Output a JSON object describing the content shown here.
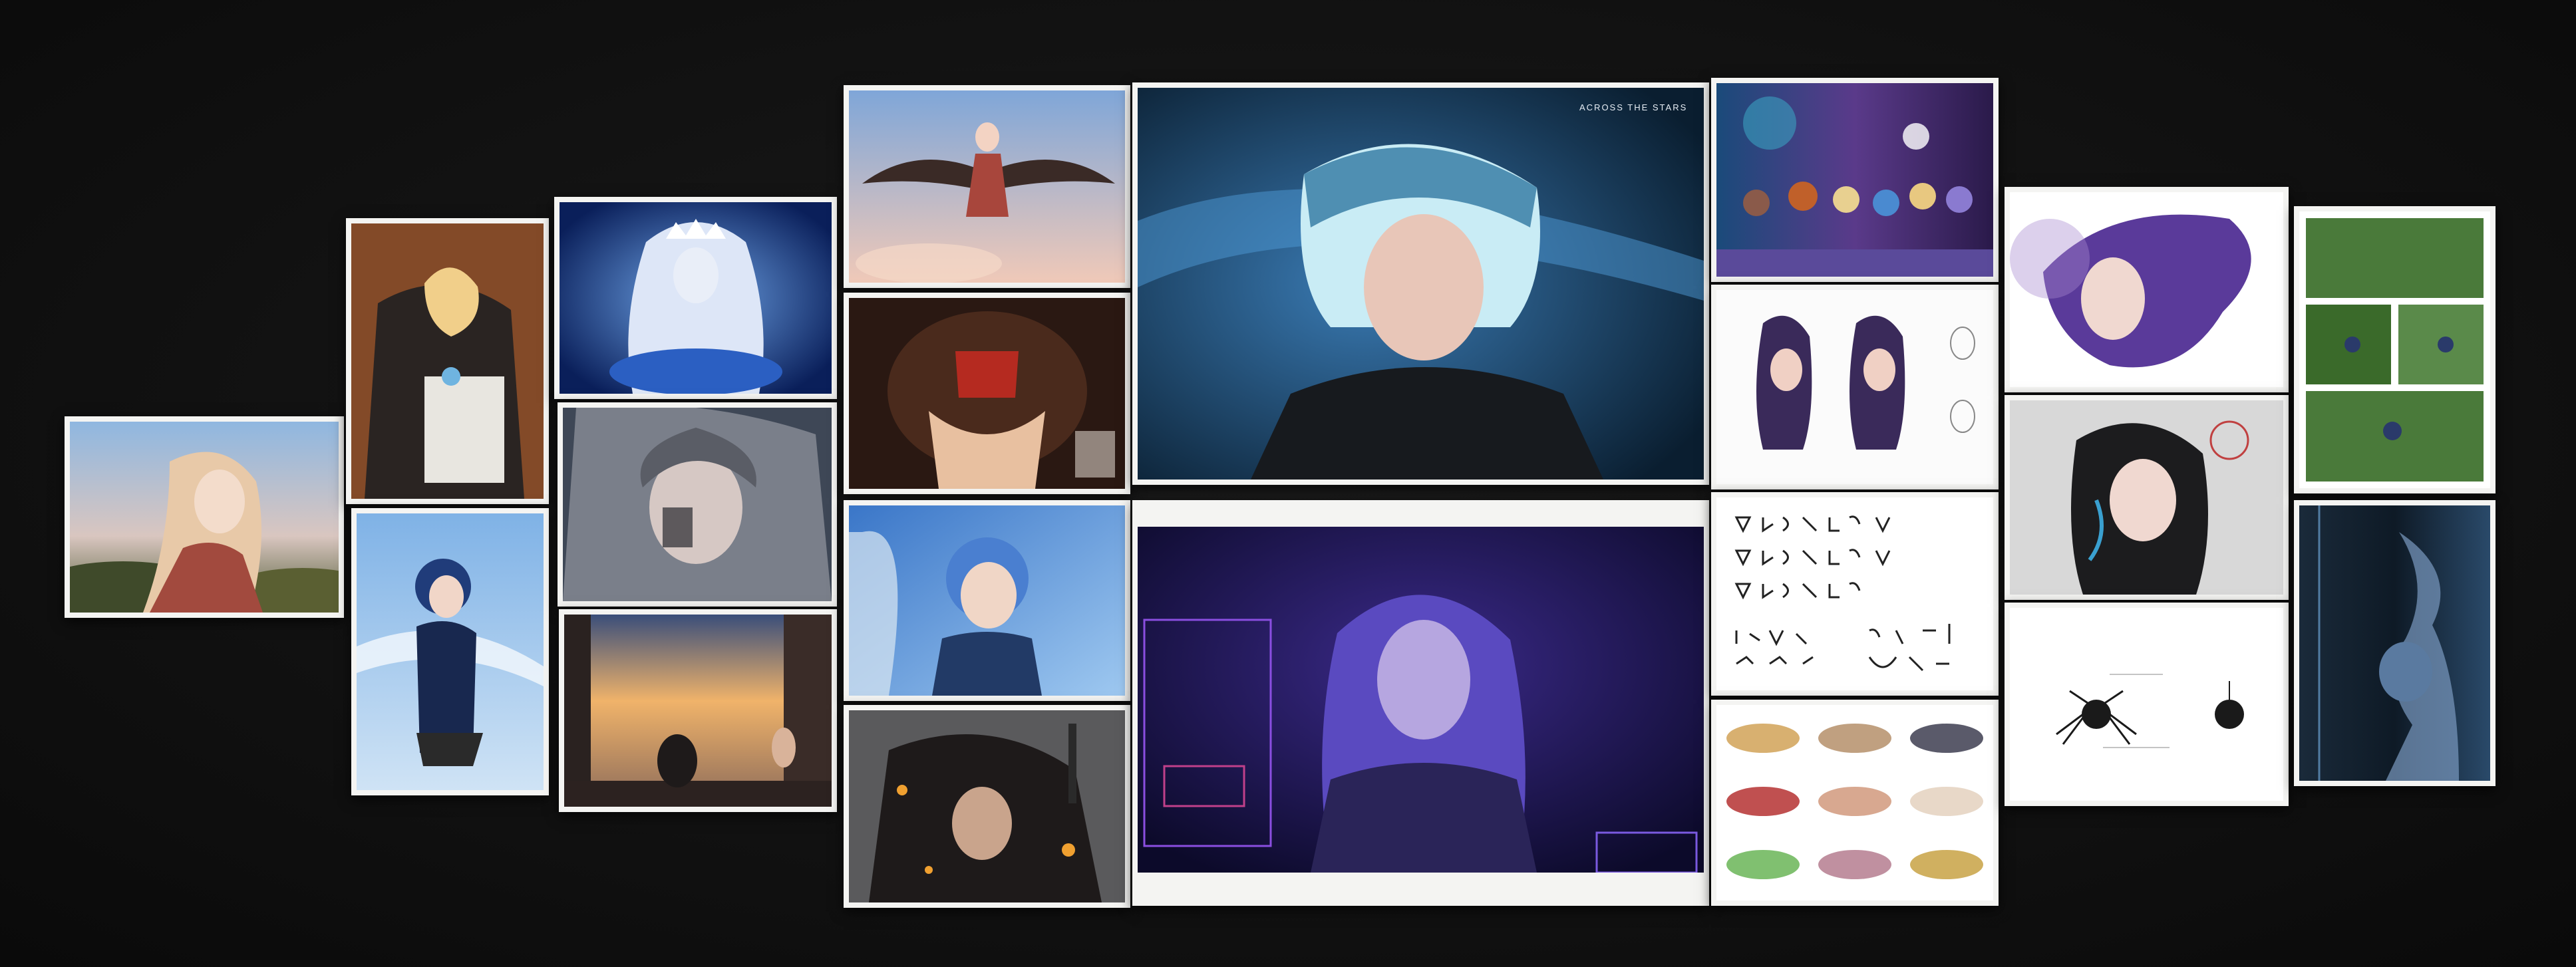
{
  "scene": {
    "background_color": "#111111",
    "description_free": true
  },
  "prints": {
    "p_large_top": {
      "corner_text": "ACROSS THE STARS"
    }
  }
}
